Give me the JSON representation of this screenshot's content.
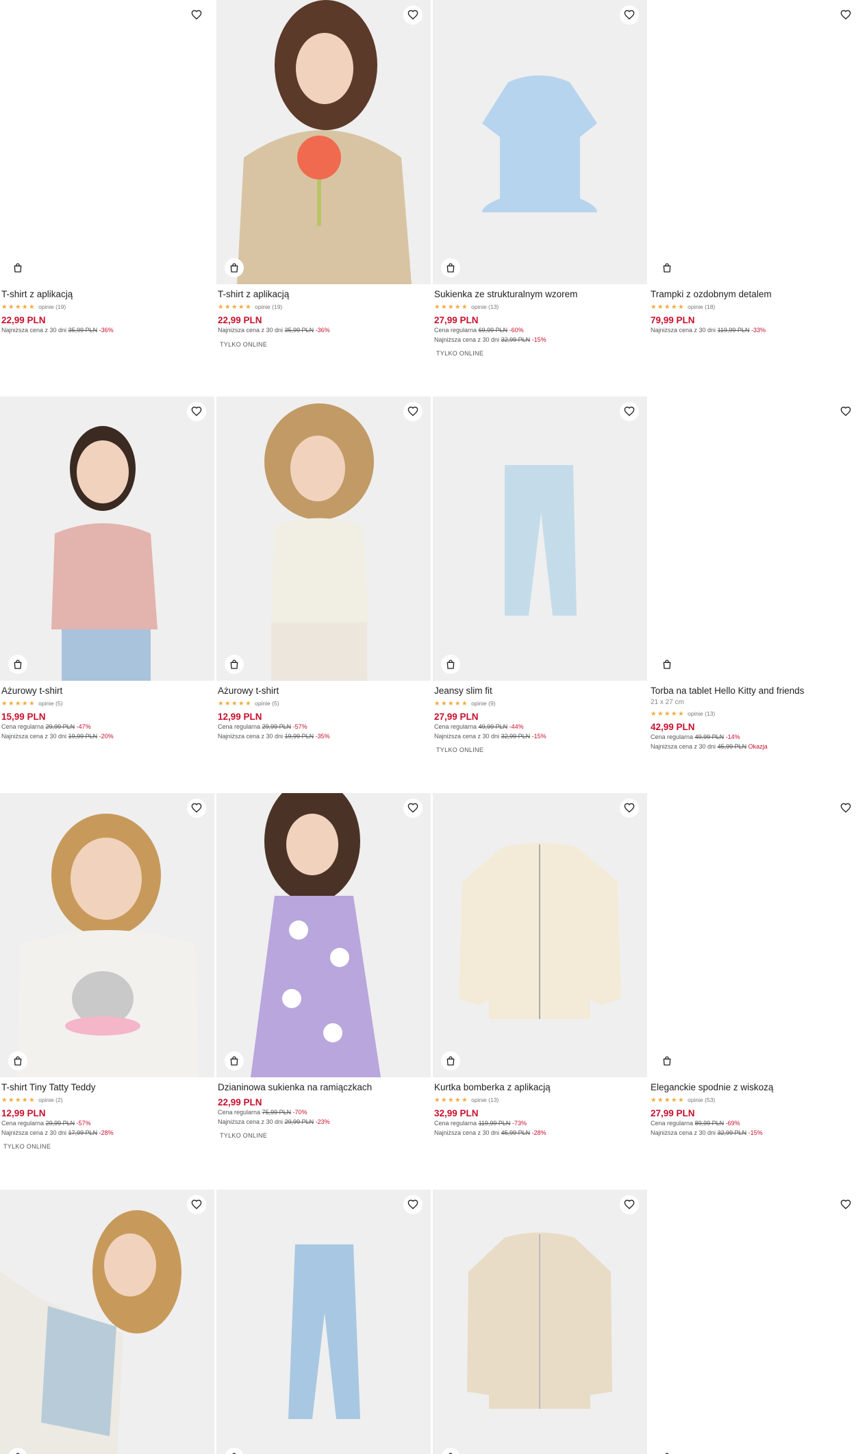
{
  "labels": {
    "lowest_price": "Najniższa cena z 30 dni",
    "regular_price": "Cena regularna",
    "online_only": "TYLKO ONLINE",
    "reviews_word": "opinie",
    "stars": "★★★★★"
  },
  "products": [
    {
      "title": "T-shirt z aplikacją",
      "reviews": "opinie (19)",
      "price": "22,99 PLN",
      "lines": [
        {
          "label": "Najniższa cena z 30 dni",
          "old": "35,99 PLN",
          "disc": "-36%"
        }
      ],
      "badge": ""
    },
    {
      "title": "T-shirt z aplikacją",
      "reviews": "opinie (19)",
      "price": "22,99 PLN",
      "lines": [
        {
          "label": "Najniższa cena z 30 dni",
          "old": "35,99 PLN",
          "disc": "-36%"
        }
      ],
      "badge": "TYLKO ONLINE"
    },
    {
      "title": "Sukienka ze strukturalnym wzorem",
      "reviews": "opinie (13)",
      "price": "27,99 PLN",
      "lines": [
        {
          "label": "Cena regularna",
          "old": "69,99 PLN",
          "disc": "-60%"
        },
        {
          "label": "Najniższa cena z 30 dni",
          "old": "32,99 PLN",
          "disc": "-15%"
        }
      ],
      "badge": "TYLKO ONLINE"
    },
    {
      "title": "Trampki z ozdobnym detalem",
      "reviews": "opinie (18)",
      "price": "79,99 PLN",
      "lines": [
        {
          "label": "Najniższa cena z 30 dni",
          "old": "119,99 PLN",
          "disc": "-33%"
        }
      ],
      "badge": ""
    },
    {
      "title": "Ażurowy t-shirt",
      "reviews": "opinie (5)",
      "price": "15,99 PLN",
      "lines": [
        {
          "label": "Cena regularna",
          "old": "29,99 PLN",
          "disc": "-47%"
        },
        {
          "label": "Najniższa cena z 30 dni",
          "old": "19,99 PLN",
          "disc": "-20%"
        }
      ],
      "badge": ""
    },
    {
      "title": "Ażurowy t-shirt",
      "reviews": "opinie (5)",
      "price": "12,99 PLN",
      "lines": [
        {
          "label": "Cena regularna",
          "old": "29,99 PLN",
          "disc": "-57%"
        },
        {
          "label": "Najniższa cena z 30 dni",
          "old": "19,99 PLN",
          "disc": "-35%"
        }
      ],
      "badge": ""
    },
    {
      "title": "Jeansy slim fit",
      "reviews": "opinie (9)",
      "price": "27,99 PLN",
      "lines": [
        {
          "label": "Cena regularna",
          "old": "49,99 PLN",
          "disc": "-44%"
        },
        {
          "label": "Najniższa cena z 30 dni",
          "old": "32,99 PLN",
          "disc": "-15%"
        }
      ],
      "badge": "TYLKO ONLINE"
    },
    {
      "title": "Torba na tablet Hello Kitty and friends",
      "subtitle": "21 x 27 cm",
      "reviews": "opinie (13)",
      "price": "42,99 PLN",
      "lines": [
        {
          "label": "Cena regularna",
          "old": "49,99 PLN",
          "disc": "-14%"
        },
        {
          "label": "Najniższa cena z 30 dni",
          "old": "45,99 PLN",
          "disc": "Okazja"
        }
      ],
      "badge": ""
    },
    {
      "title": "T-shirt Tiny Tatty Teddy",
      "reviews": "opinie (2)",
      "price": "12,99 PLN",
      "lines": [
        {
          "label": "Cena regularna",
          "old": "29,99 PLN",
          "disc": "-57%"
        },
        {
          "label": "Najniższa cena z 30 dni",
          "old": "17,99 PLN",
          "disc": "-28%"
        }
      ],
      "badge": "TYLKO ONLINE"
    },
    {
      "title": "Dzianinowa sukienka na ramiączkach",
      "reviews": "",
      "price": "22,99 PLN",
      "lines": [
        {
          "label": "Cena regularna",
          "old": "75,99 PLN",
          "disc": "-70%"
        },
        {
          "label": "Najniższa cena z 30 dni",
          "old": "29,99 PLN",
          "disc": "-23%"
        }
      ],
      "badge": "TYLKO ONLINE"
    },
    {
      "title": "Kurtka bomberka z aplikacją",
      "reviews": "opinie (13)",
      "price": "32,99 PLN",
      "lines": [
        {
          "label": "Cena regularna",
          "old": "119,99 PLN",
          "disc": "-73%"
        },
        {
          "label": "Najniższa cena z 30 dni",
          "old": "45,99 PLN",
          "disc": "-28%"
        }
      ],
      "badge": ""
    },
    {
      "title": "Eleganckie spodnie z wiskozą",
      "reviews": "opinie (53)",
      "price": "27,99 PLN",
      "lines": [
        {
          "label": "Cena regularna",
          "old": "89,99 PLN",
          "disc": "-69%"
        },
        {
          "label": "Najniższa cena z 30 dni",
          "old": "32,99 PLN",
          "disc": "-15%"
        }
      ],
      "badge": ""
    },
    {
      "title": "",
      "reviews": "",
      "price": "",
      "lines": [],
      "badge": ""
    },
    {
      "title": "",
      "reviews": "",
      "price": "",
      "lines": [],
      "badge": ""
    },
    {
      "title": "",
      "reviews": "",
      "price": "",
      "lines": [],
      "badge": ""
    },
    {
      "title": "",
      "reviews": "",
      "price": "",
      "lines": [],
      "badge": ""
    }
  ],
  "icons": {
    "favorite": "heart-icon",
    "cart": "shopping-bag-icon"
  },
  "colors": {
    "price_red": "#c8102e",
    "star_orange": "#f2a93b",
    "image_bg": "#efefef"
  }
}
